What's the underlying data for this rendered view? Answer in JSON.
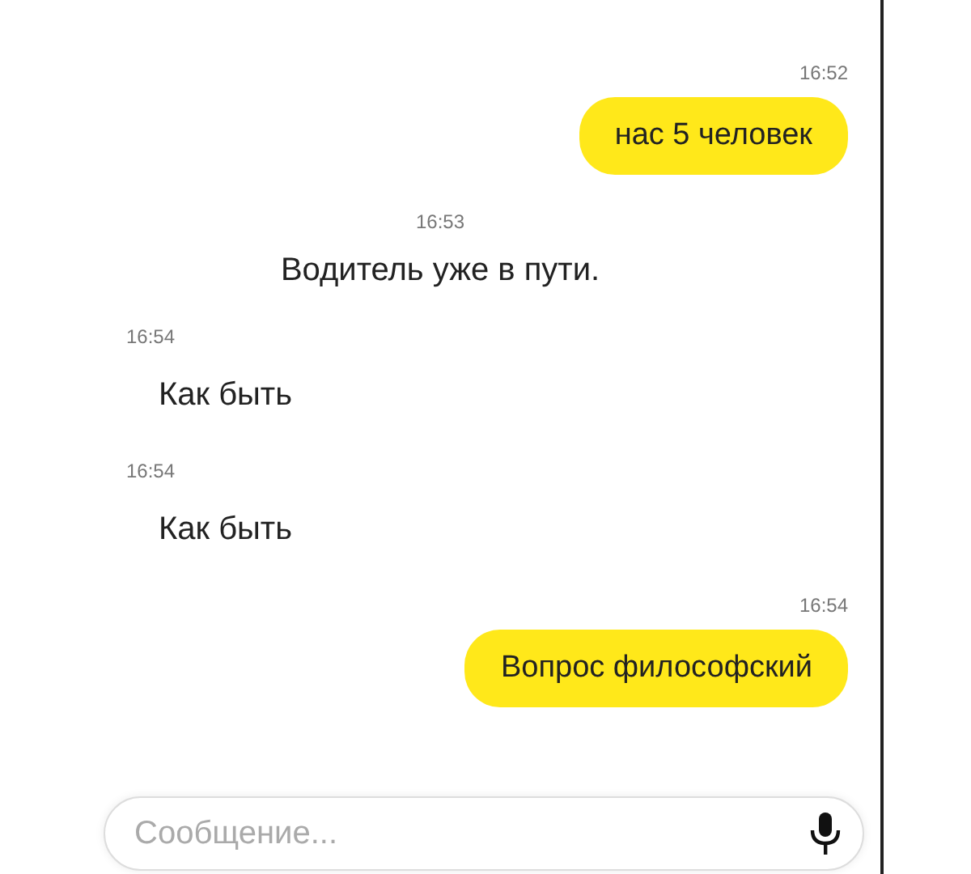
{
  "messages": [
    {
      "kind": "outgoing",
      "time": "16:52",
      "text": "нас 5 человек"
    },
    {
      "kind": "system",
      "time": "16:53",
      "text": "Водитель уже в пути."
    },
    {
      "kind": "incoming",
      "time": "16:54",
      "text": "Как быть"
    },
    {
      "kind": "incoming",
      "time": "16:54",
      "text": "Как быть"
    },
    {
      "kind": "outgoing",
      "time": "16:54",
      "text": "Вопрос философский"
    }
  ],
  "composer": {
    "placeholder": "Сообщение..."
  }
}
